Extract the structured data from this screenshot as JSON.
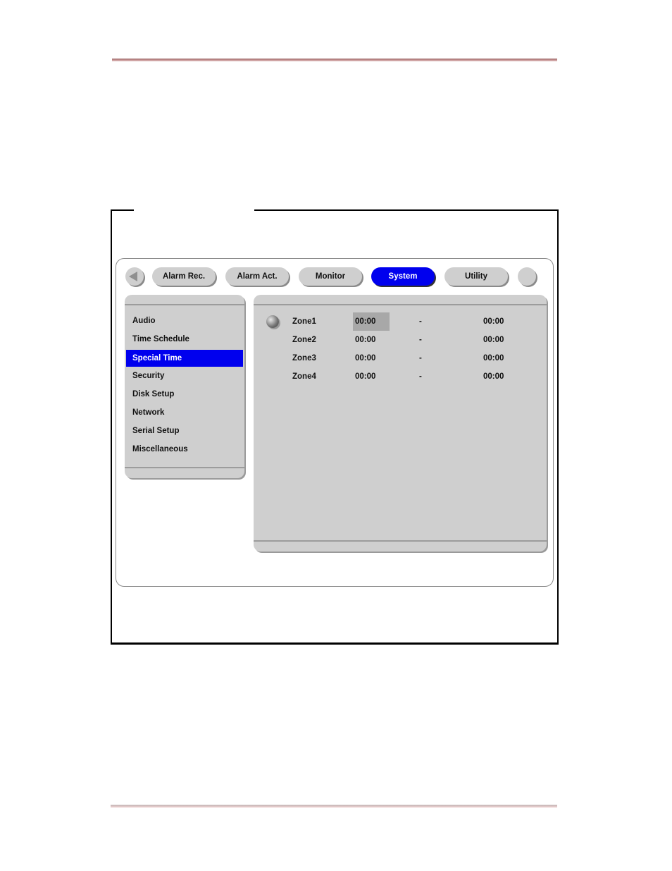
{
  "tabs": {
    "back_icon": "left-triangle",
    "items": [
      {
        "label": "Alarm Rec.",
        "active": false
      },
      {
        "label": "Alarm Act.",
        "active": false
      },
      {
        "label": "Monitor",
        "active": false
      },
      {
        "label": "System",
        "active": true
      },
      {
        "label": "Utility",
        "active": false
      }
    ]
  },
  "sidebar": {
    "items": [
      {
        "label": "Audio"
      },
      {
        "label": "Time Schedule"
      },
      {
        "label": "Special Time",
        "active": true
      },
      {
        "label": "Security"
      },
      {
        "label": "Disk Setup"
      },
      {
        "label": "Network"
      },
      {
        "label": "Serial Setup"
      },
      {
        "label": "Miscellaneous"
      }
    ]
  },
  "zones": {
    "separator": "-",
    "rows": [
      {
        "name": "Zone1",
        "start": "00:00",
        "end": "00:00",
        "selected": true
      },
      {
        "name": "Zone2",
        "start": "00:00",
        "end": "00:00"
      },
      {
        "name": "Zone3",
        "start": "00:00",
        "end": "00:00"
      },
      {
        "name": "Zone4",
        "start": "00:00",
        "end": "00:00"
      }
    ]
  },
  "colors": {
    "accent": "#0000ee",
    "panel": "#cfcfcf",
    "selected_cell": "#a8a8a8",
    "page_rule": "#b07a7a"
  }
}
